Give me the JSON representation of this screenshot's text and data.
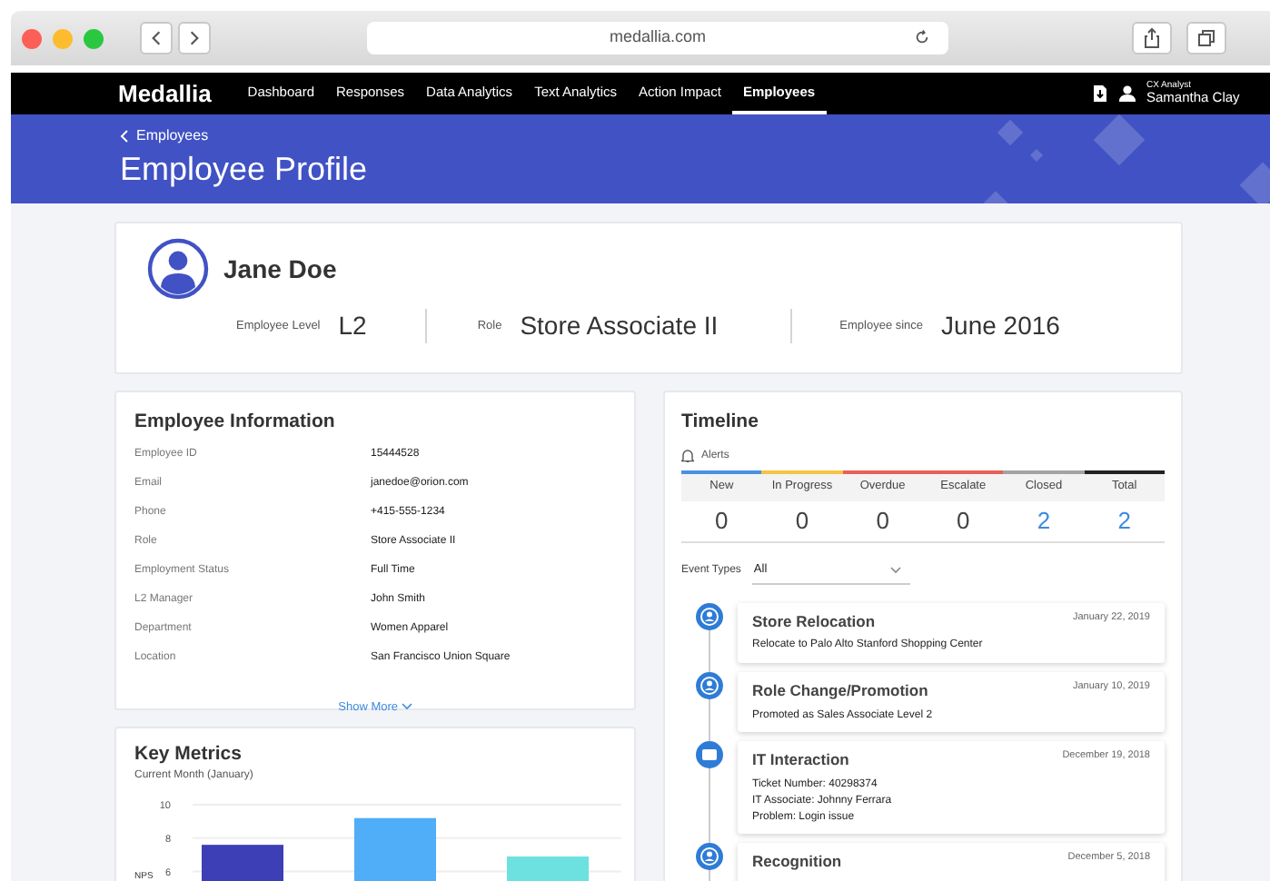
{
  "browser": {
    "url": "medallia.com"
  },
  "nav": {
    "logo": "Medallia",
    "items": [
      {
        "label": "Dashboard",
        "selected": false
      },
      {
        "label": "Responses",
        "selected": false
      },
      {
        "label": "Data Analytics",
        "selected": false
      },
      {
        "label": "Text Analytics",
        "selected": false
      },
      {
        "label": "Action Impact",
        "selected": false
      },
      {
        "label": "Employees",
        "selected": true
      }
    ],
    "user": {
      "role": "CX Analyst",
      "name": "Samantha Clay"
    }
  },
  "header": {
    "breadcrumb": "Employees",
    "title": "Employee Profile"
  },
  "profile": {
    "name": "Jane Doe",
    "stats": [
      {
        "label": "Employee Level",
        "value": "L2"
      },
      {
        "label": "Role",
        "value": "Store Associate II"
      },
      {
        "label": "Employee since",
        "value": "June 2016"
      }
    ]
  },
  "employee_information": {
    "title": "Employee Information",
    "fields": [
      {
        "label": "Employee ID",
        "value": "15444528"
      },
      {
        "label": "Email",
        "value": "janedoe@orion.com"
      },
      {
        "label": "Phone",
        "value": "+415-555-1234"
      },
      {
        "label": "Role",
        "value": "Store Associate II"
      },
      {
        "label": "Employment Status",
        "value": "Full Time"
      },
      {
        "label": "L2 Manager",
        "value": "John Smith"
      },
      {
        "label": "Department",
        "value": "Women Apparel"
      },
      {
        "label": "Location",
        "value": "San Francisco Union Square"
      }
    ],
    "show_more": "Show More"
  },
  "key_metrics": {
    "title": "Key Metrics",
    "subtitle": "Current Month (January)",
    "chart_data": {
      "type": "bar",
      "ylabel": "NPS",
      "ylim": [
        0,
        10
      ],
      "yticks": [
        6,
        8,
        10
      ],
      "series": [
        {
          "color": "#3d3fb6",
          "values": [
            7.6,
            null,
            null
          ]
        },
        {
          "color": "#50adf7",
          "values": [
            null,
            9.2,
            null
          ]
        },
        {
          "color": "#6ce1e0",
          "values": [
            null,
            null,
            6.9
          ]
        }
      ]
    }
  },
  "timeline": {
    "title": "Timeline",
    "alerts_label": "Alerts",
    "statuses": [
      {
        "label": "New",
        "count": "0",
        "color": "#4a90e2",
        "link": false
      },
      {
        "label": "In Progress",
        "count": "0",
        "color": "#f5c445",
        "link": false
      },
      {
        "label": "Overdue",
        "count": "0",
        "color": "#e8605a",
        "link": false
      },
      {
        "label": "Escalate",
        "count": "0",
        "color": "#e8605a",
        "link": false
      },
      {
        "label": "Closed",
        "count": "2",
        "color": "#a3a3a3",
        "link": true
      },
      {
        "label": "Total",
        "count": "2",
        "color": "#222222",
        "link": true
      }
    ],
    "filter": {
      "label": "Event Types",
      "value": "All"
    },
    "events": [
      {
        "kind": "person",
        "title": "Store Relocation",
        "date": "January 22, 2019",
        "lines": [
          "Relocate to Palo Alto Stanford Shopping Center"
        ]
      },
      {
        "kind": "person",
        "title": "Role Change/Promotion",
        "date": "January 10, 2019",
        "lines": [
          "Promoted as Sales Associate Level 2"
        ]
      },
      {
        "kind": "ticket",
        "title": "IT Interaction",
        "date": "December 19, 2018",
        "lines": [
          "Ticket Number: 40298374",
          "IT Associate: Johnny Ferrara",
          "Problem: Login issue"
        ]
      },
      {
        "kind": "person",
        "title": "Recognition",
        "date": "December 5, 2018"
      }
    ]
  }
}
